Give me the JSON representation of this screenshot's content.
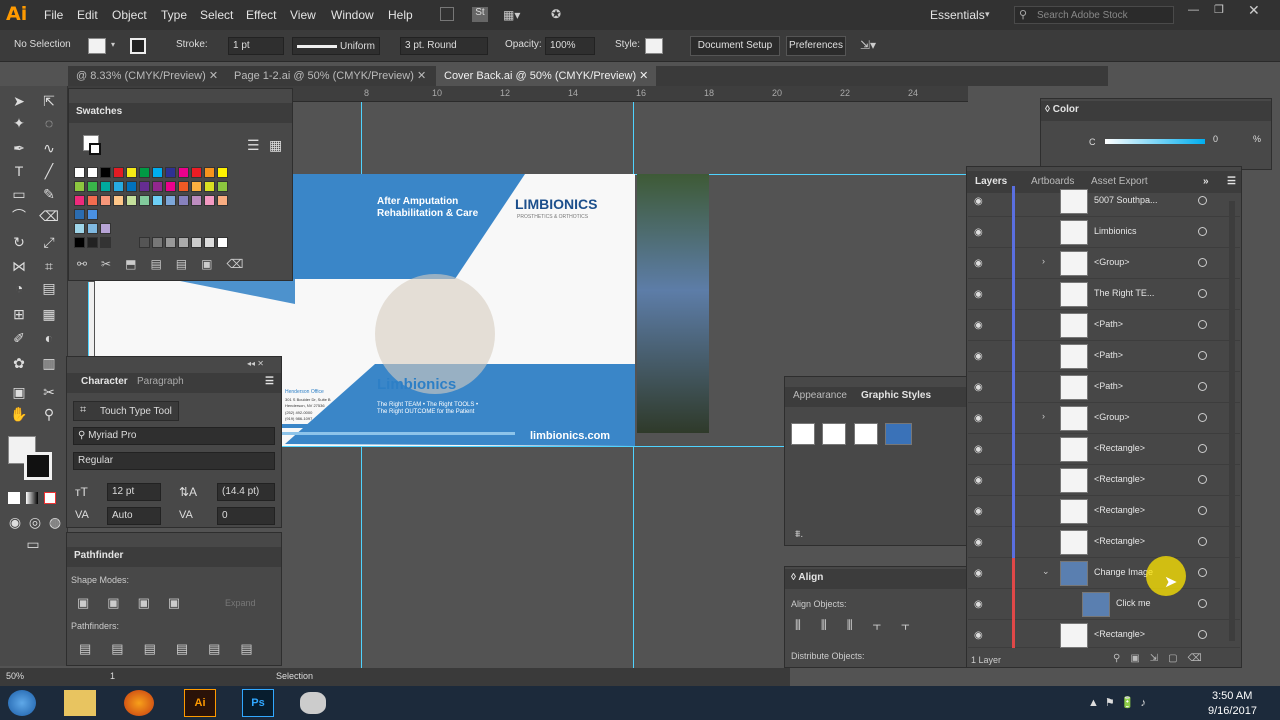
{
  "app": {
    "logo": "Ai",
    "workspace": "Essentials",
    "search_placeholder": "Search Adobe Stock"
  },
  "menu": [
    "File",
    "Edit",
    "Object",
    "Type",
    "Select",
    "Effect",
    "View",
    "Window",
    "Help"
  ],
  "control": {
    "selection": "No Selection",
    "stroke_label": "Stroke:",
    "stroke_value": "1 pt",
    "stroke_style": "Uniform",
    "brush": "3 pt. Round",
    "opacity_label": "Opacity:",
    "opacity_value": "100%",
    "style_label": "Style:",
    "doc_setup": "Document Setup",
    "preferences": "Preferences"
  },
  "tabs": [
    {
      "label": "@ 8.33% (CMYK/Preview)"
    },
    {
      "label": "Page 1-2.ai @ 50% (CMYK/Preview)"
    },
    {
      "label": "Cover Back.ai @ 50% (CMYK/Preview)"
    }
  ],
  "ruler": [
    "8",
    "10",
    "12",
    "14",
    "16",
    "18",
    "20",
    "22",
    "24"
  ],
  "swatches": {
    "title": "Swatches"
  },
  "character": {
    "tab1": "Character",
    "tab2": "Paragraph",
    "touch": "Touch Type Tool",
    "font": "Myriad Pro",
    "style": "Regular",
    "size": "12 pt",
    "leading": "(14.4 pt)",
    "kerning": "Auto",
    "tracking": "0"
  },
  "pathfinder": {
    "title": "Pathfinder",
    "shape_modes": "Shape Modes:",
    "pathfinders": "Pathfinders:",
    "expand": "Expand"
  },
  "artwork": {
    "heading1": "After Amputation",
    "heading2": "Rehabilitation & Care",
    "logo": "LIMBIONICS",
    "logo_sub": "PROSTHETICS & ORTHOTICS",
    "brand": "Limbionics",
    "tagline1": "The Right TEAM • The Right TOOLS •",
    "tagline2": "The Right OUTCOME for the Patient",
    "url": "limbionics.com",
    "office": "Henderson Office",
    "addr1": "301 S Boulder Dr, Suite B",
    "addr2": "Henderson, NV 27536",
    "ph1": "(252) 492-0000",
    "ph2": "(919) 986-1097"
  },
  "appearance": {
    "tab1": "Appearance",
    "tab2": "Graphic Styles"
  },
  "align": {
    "title": "Align",
    "objects": "Align Objects:",
    "distribute": "Distribute Objects:"
  },
  "color": {
    "title": "Color",
    "c_label": "C",
    "c_value": "0",
    "pct": "%"
  },
  "layers": {
    "tab1": "Layers",
    "tab2": "Artboards",
    "tab3": "Asset Export",
    "count": "1 Layer",
    "rows": [
      {
        "name": "5007 Southpa..."
      },
      {
        "name": "Limbionics"
      },
      {
        "name": "<Group>"
      },
      {
        "name": "The Right TE..."
      },
      {
        "name": "<Path>"
      },
      {
        "name": "<Path>"
      },
      {
        "name": "<Path>"
      },
      {
        "name": "<Group>"
      },
      {
        "name": "<Rectangle>"
      },
      {
        "name": "<Rectangle>"
      },
      {
        "name": "<Rectangle>"
      },
      {
        "name": "<Rectangle>"
      },
      {
        "name": "Change Image"
      },
      {
        "name": "Click me"
      },
      {
        "name": "<Rectangle>"
      }
    ]
  },
  "status": {
    "zoom": "50%",
    "page": "1",
    "tool": "Selection"
  },
  "taskbar": {
    "time": "3:50 AM",
    "date": "9/16/2017"
  }
}
